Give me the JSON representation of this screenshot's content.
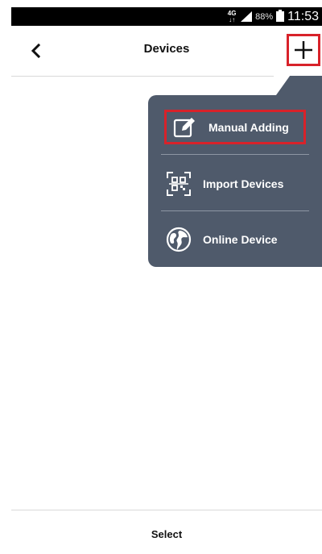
{
  "status_bar": {
    "network_top": "4G",
    "network_bottom": "↓↑",
    "battery_percent": "88%",
    "time": "11:53"
  },
  "header": {
    "title": "Devices",
    "back_icon": "chevron-left-icon",
    "add_icon": "plus-icon"
  },
  "popup_menu": {
    "items": [
      {
        "label": "Manual Adding",
        "icon": "edit-icon"
      },
      {
        "label": "Import Devices",
        "icon": "qr-scan-icon"
      },
      {
        "label": "Online Device",
        "icon": "globe-icon"
      }
    ]
  },
  "bottom_bar": {
    "select_label": "Select"
  },
  "colors": {
    "popup_bg": "#4f5a6b",
    "highlight": "#d8222a"
  }
}
